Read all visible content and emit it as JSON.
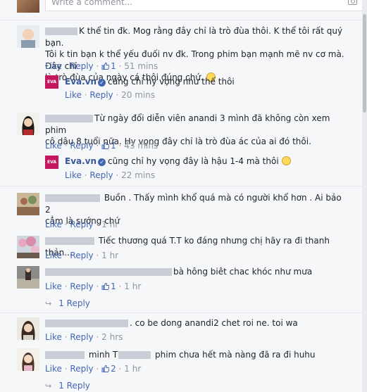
{
  "write_box": {
    "placeholder": "Write a comment..."
  },
  "labels": {
    "like": "Like",
    "reply": "Reply",
    "dot": "·"
  },
  "comments": [
    {
      "text": "K thể tin đk. Mog rằng đây chỉ là trò đùa thôi. K thể tôi rất quý bạn. Tôi k tin bạn k thể yếu đuối nv đk. Trong phim bạn mạnh mẽ nv cơ mà. Đây chỉ là trò đùa của ngày cá thôi đúng chứ.",
      "line1": "K thể tin đk. Mog rằng đây chỉ là trò đùa thôi. K thể tôi rất quý bạn.",
      "line2": "Tôi k tin bạn k thể yếu đuối nv đk. Trong phim bạn mạnh mẽ nv cơ mà. Đây chỉ",
      "line3": "là trò đùa của ngày cá thôi đúng chứ.",
      "likes": "1",
      "time": "51 mins",
      "reply": {
        "name": "Eva.vn",
        "text": "cũng chỉ hy vọng như thế thôi",
        "time": "20 mins"
      }
    },
    {
      "line1": "Từ ngày đổi diễn viên anandi 3 mình đã không còn xem phim",
      "line2": "cô dâu 8 tuổi nữa. Hy vọng đây chỉ là trò đùa ác của ai đó thôi.",
      "likes": "1",
      "time": "43 mins",
      "reply": {
        "name": "Eva.vn",
        "text": "cũng chỉ hy vọng đây là hậu 1-4 mà thôi",
        "time": "22 mins"
      }
    },
    {
      "line1": "Buồn . Thấy mình khổ quá mà có người khổ hơn . Ai bảo 2",
      "line2": "cẳm là sướng chứ",
      "time": "1 hr"
    },
    {
      "line1": "Tiếc thương quá T.T ko đáng nhưng chị hãy ra đi thanh thản...",
      "time": "1 hr"
    },
    {
      "line1": "bà hông biêt chac khóc như mưa",
      "likes": "1",
      "time": "1 hr",
      "replies": "1 Reply"
    },
    {
      "line1": ". co be dong anandi2 chet roi ne. toi wa",
      "time": "2 hrs"
    },
    {
      "line1_a": "minh T",
      "line1_b": "phim chưa hết mà nàng đã ra đi huhu",
      "likes": "2",
      "time": "1 hr",
      "replies": "1 Reply"
    }
  ],
  "eva_logo_text": "EVA",
  "colors": {
    "link": "#4267b2",
    "name": "#365899",
    "meta": "#90949c",
    "background": "#f6f7f9"
  }
}
